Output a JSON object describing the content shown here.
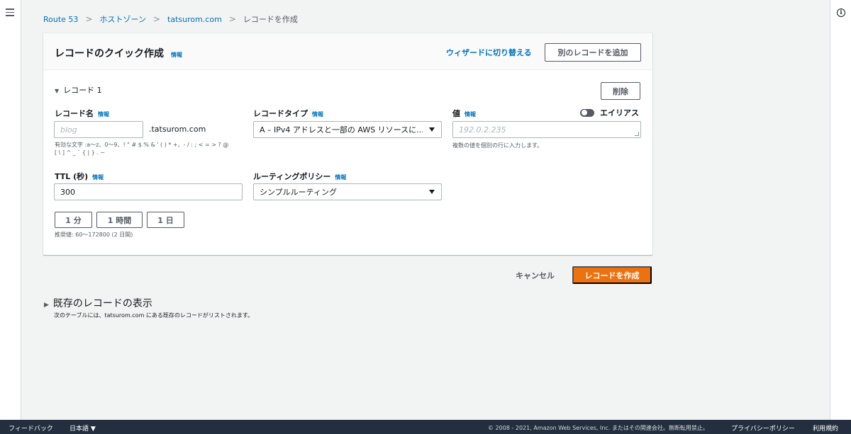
{
  "breadcrumb": {
    "items": [
      "Route 53",
      "ホストゾーン",
      "tatsurom.com"
    ],
    "current": "レコードを作成",
    "separator": ">"
  },
  "panel": {
    "title": "レコードのクイック作成",
    "info": "情報",
    "wizard_link": "ウィザードに切り替える",
    "add_record_button": "別のレコードを追加"
  },
  "record": {
    "toggle_label": "レコード 1",
    "delete_button": "削除",
    "name": {
      "label": "レコード名",
      "info": "情報",
      "placeholder": "blog",
      "domain_suffix": ".tatsurom.com",
      "hint_line1": "有効な文字 :a〜z、0〜9、! \" # $ % & ' ( ) * +、- / : ; < = > ? @",
      "hint_line2": "[ \\ ] ^ _ ` { | } . ~"
    },
    "type": {
      "label": "レコードタイプ",
      "info": "情報",
      "value": "A – IPv4 アドレスと一部の AWS リソースに..."
    },
    "value": {
      "label": "値",
      "info": "情報",
      "placeholder": "192.0.2.235",
      "hint": "複数の値を個別の行に入力します。"
    },
    "alias": {
      "label": "エイリアス",
      "enabled": false
    },
    "ttl": {
      "label": "TTL (秒)",
      "info": "情報",
      "value": "300",
      "presets": [
        "1 分",
        "1 時間",
        "1 日"
      ],
      "hint": "推奨値: 60〜172800 (2 日間)"
    },
    "routing": {
      "label": "ルーティングポリシー",
      "info": "情報",
      "value": "シンプルルーティング"
    }
  },
  "actions": {
    "cancel": "キャンセル",
    "create": "レコードを作成"
  },
  "existing": {
    "title": "既存のレコードの表示",
    "description": "次のテーブルには、tatsurom.com にある既存のレコードがリストされます。"
  },
  "footer": {
    "feedback": "フィードバック",
    "language": "日本語 ▼",
    "copyright": "© 2008 - 2021, Amazon Web Services, Inc. またはその関連会社。無断転用禁止。",
    "privacy": "プライバシーポリシー",
    "terms": "利用規約"
  },
  "colors": {
    "link": "#0073bb",
    "primary": "#ec7211",
    "footer_bg": "#232f3e",
    "page_bg": "#f2f3f3"
  },
  "icons": {
    "menu": "hamburger-icon",
    "info": "info-circle-icon"
  }
}
